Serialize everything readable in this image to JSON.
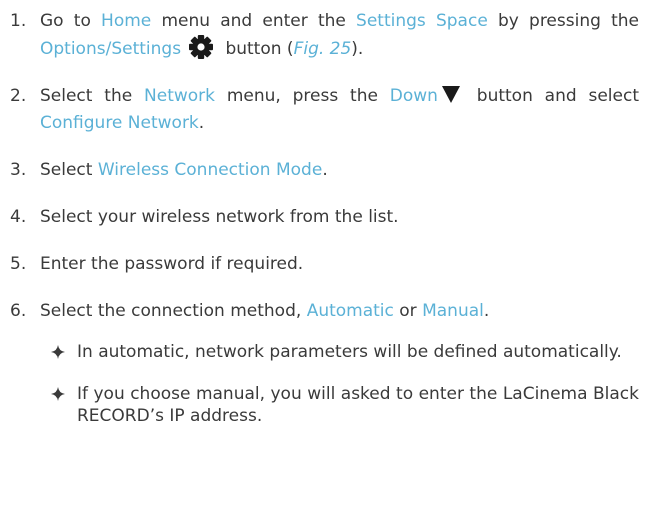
{
  "steps": [
    {
      "number": "1.",
      "parts": {
        "t1": "Go to ",
        "h1": "Home",
        "t2": " menu and enter the ",
        "h2": "Settings Space",
        "t3": " by pressing the ",
        "h3": "Options/Settings",
        "t4": " button (",
        "fig": "Fig. 25",
        "t5": ")."
      },
      "icon": "gear-icon"
    },
    {
      "number": "2.",
      "parts": {
        "t1": "Select the ",
        "h1": "Network",
        "t2": " menu, press the ",
        "h2": "Down",
        "t3": " button and select ",
        "h3": "Configure Network",
        "t4": "."
      },
      "icon": "down-triangle-icon"
    },
    {
      "number": "3.",
      "parts": {
        "t1": "Select ",
        "h1": "Wireless Connection Mode",
        "t2": "."
      }
    },
    {
      "number": "4.",
      "parts": {
        "t1": "Select your wireless network from the list."
      }
    },
    {
      "number": "5.",
      "parts": {
        "t1": "Enter the password if required."
      }
    },
    {
      "number": "6.",
      "parts": {
        "t1": "Select the connection method, ",
        "h1": "Automatic",
        "t2": " or ",
        "h2": "Manual",
        "t3": "."
      }
    }
  ],
  "bullets": [
    "In automatic, network parameters will be defined automatically.",
    "If you choose manual, you will asked to enter the LaCinema Black RECORD’s IP address."
  ],
  "colors": {
    "text": "#3a3a3a",
    "highlight": "#5bb1d6"
  },
  "bullet_icon": "four-point-star-icon"
}
